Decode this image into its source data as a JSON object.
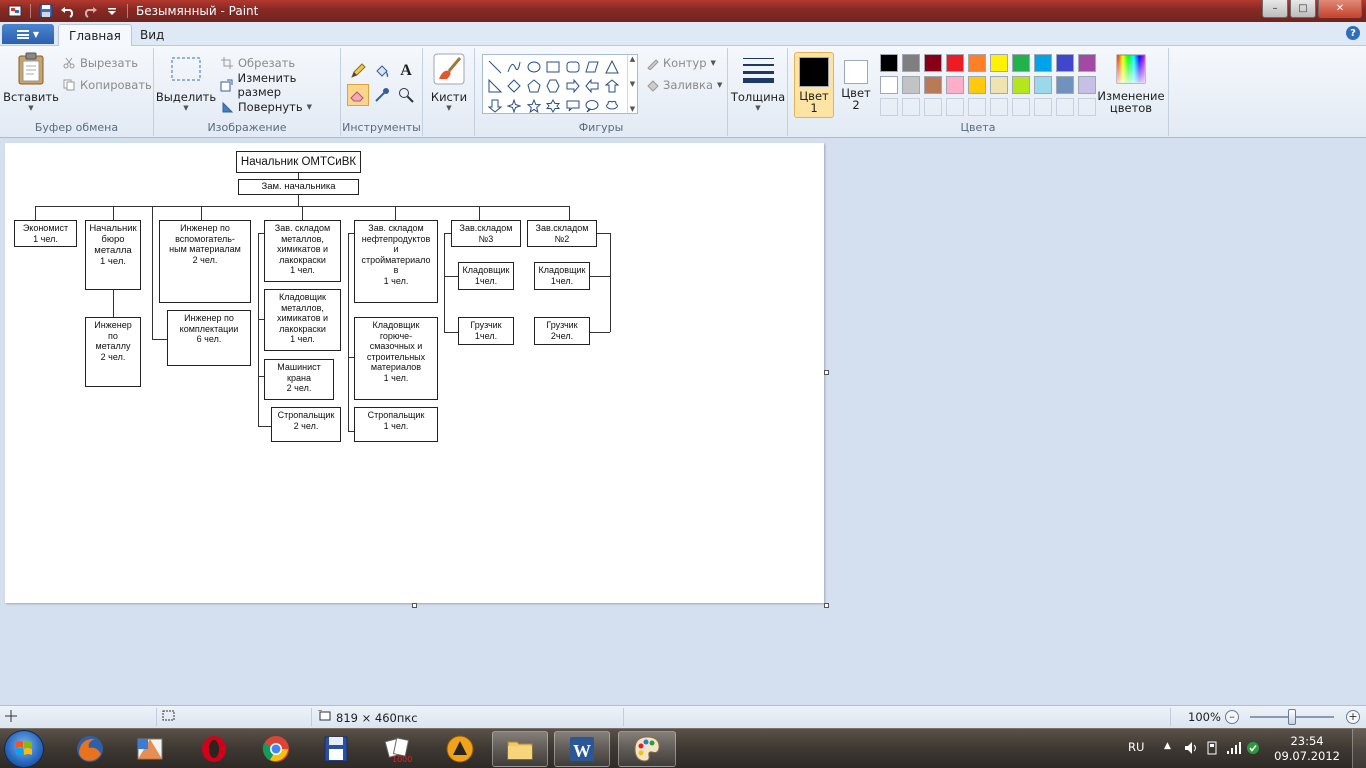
{
  "window": {
    "title": "Безымянный - Paint",
    "controls": {
      "minimize": "–",
      "maximize": "□",
      "close": "✕"
    }
  },
  "tabs": {
    "home": "Главная",
    "view": "Вид",
    "help": "?"
  },
  "ribbon": {
    "clipboard": {
      "label": "Буфер обмена",
      "paste": "Вставить",
      "cut": "Вырезать",
      "copy": "Копировать"
    },
    "image": {
      "label": "Изображение",
      "select": "Выделить",
      "crop": "Обрезать",
      "resize": "Изменить размер",
      "rotate": "Повернуть"
    },
    "tools": {
      "label": "Инструменты"
    },
    "brushes": {
      "label": "Кисти"
    },
    "shapes": {
      "label": "Фигуры",
      "outline": "Контур",
      "fill": "Заливка"
    },
    "thickness": {
      "label": "Толщина"
    },
    "colors": {
      "label": "Цвета",
      "color1": "Цвет\n1",
      "color2": "Цвет\n2",
      "edit": "Изменение\nцветов",
      "color1_value": "#000000",
      "color2_value": "#ffffff",
      "palette_row1": [
        "#000000",
        "#7f7f7f",
        "#880015",
        "#ed1c24",
        "#ff7f27",
        "#fff200",
        "#22b14c",
        "#00a2e8",
        "#3f48cc",
        "#a349a4"
      ],
      "palette_row2": [
        "#ffffff",
        "#c3c3c3",
        "#b97a57",
        "#ffaec9",
        "#ffc90e",
        "#efe4b0",
        "#b5e61d",
        "#99d9ea",
        "#7092be",
        "#c8bfe7"
      ]
    }
  },
  "org": {
    "head": "Начальник ОМТСиВК",
    "deputy": "Зам. начальника",
    "economist": "Экономист\n1 чел.",
    "metal_chief": "Начальник\nбюро\nметалла\n1 чел.",
    "metal_engineer": "Инженер\nпо\nметаллу\n2 чел.",
    "aux_engineer": "Инженер по\nвспомогатель-\nным материалам\n2 чел.",
    "kit_engineer": "Инженер по\nкомплектации\n6 чел.",
    "wh_metals_head": "Зав. складом\nметаллов,\nхимикатов и\nлакокраски\n1 чел.",
    "wh_metals_keeper": "Кладовщик\nметаллов,\nхимикатов и\nлакокраски\n1 чел.",
    "crane_operator": "Машинист\nкрана\n2 чел.",
    "slinger_a": "Стропальщик\n2 чел.",
    "wh_oil_head": "Зав. складом\nнефтепродуктов\nи\nстройматериало\nв\n1 чел.",
    "wh_oil_keeper": "Кладовщик\nгорюче-\nсмазочных и\nстроительных\nматериалов\n1 чел.",
    "slinger_b": "Стропальщик\n1 чел.",
    "wh3_head": "Зав.складом\n№3",
    "wh3_keeper": "Кладовщик\n1чел.",
    "wh3_loader": "Грузчик\n1чел.",
    "wh2_head": "Зав.складом\n№2",
    "wh2_keeper": "Кладовщик\n1чел.",
    "wh2_loader": "Грузчик\n2чел."
  },
  "status": {
    "dimensions": "819 × 460пкс",
    "zoom": "100%"
  },
  "tray": {
    "lang": "RU",
    "time": "23:54",
    "date": "09.07.2012"
  }
}
